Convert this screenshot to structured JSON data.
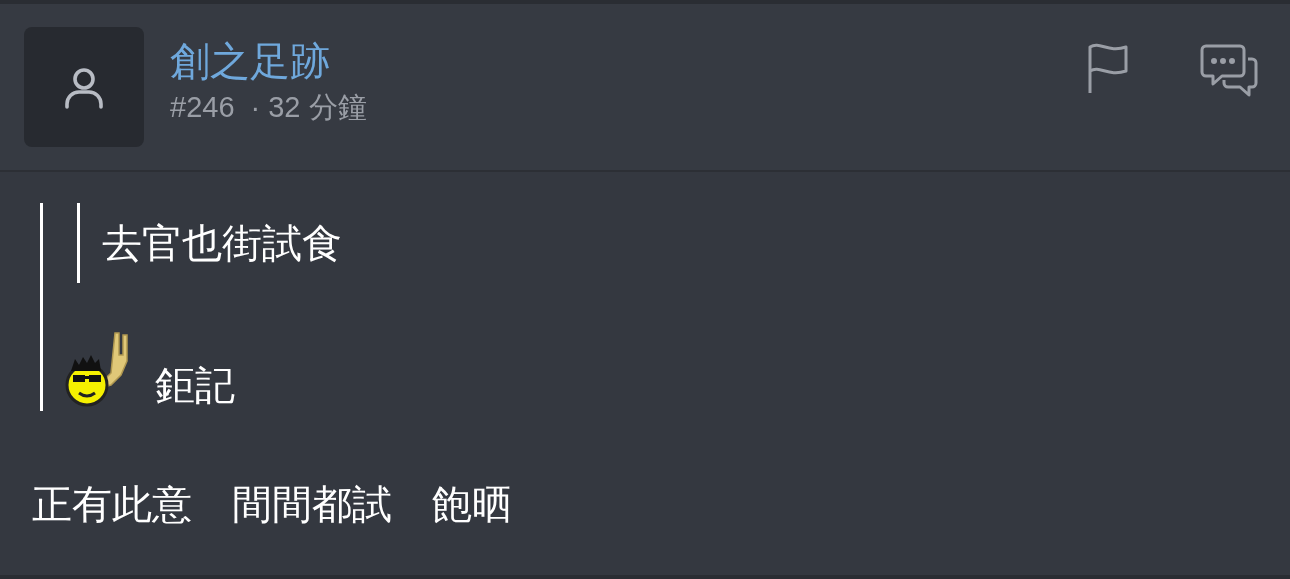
{
  "post": {
    "username": "創之足跡",
    "number": "#246",
    "time": "· 32 分鐘"
  },
  "quote": {
    "nested_quote": "去官也街試食",
    "text": "鉅記"
  },
  "body": "正有此意　間間都試　飽晒"
}
